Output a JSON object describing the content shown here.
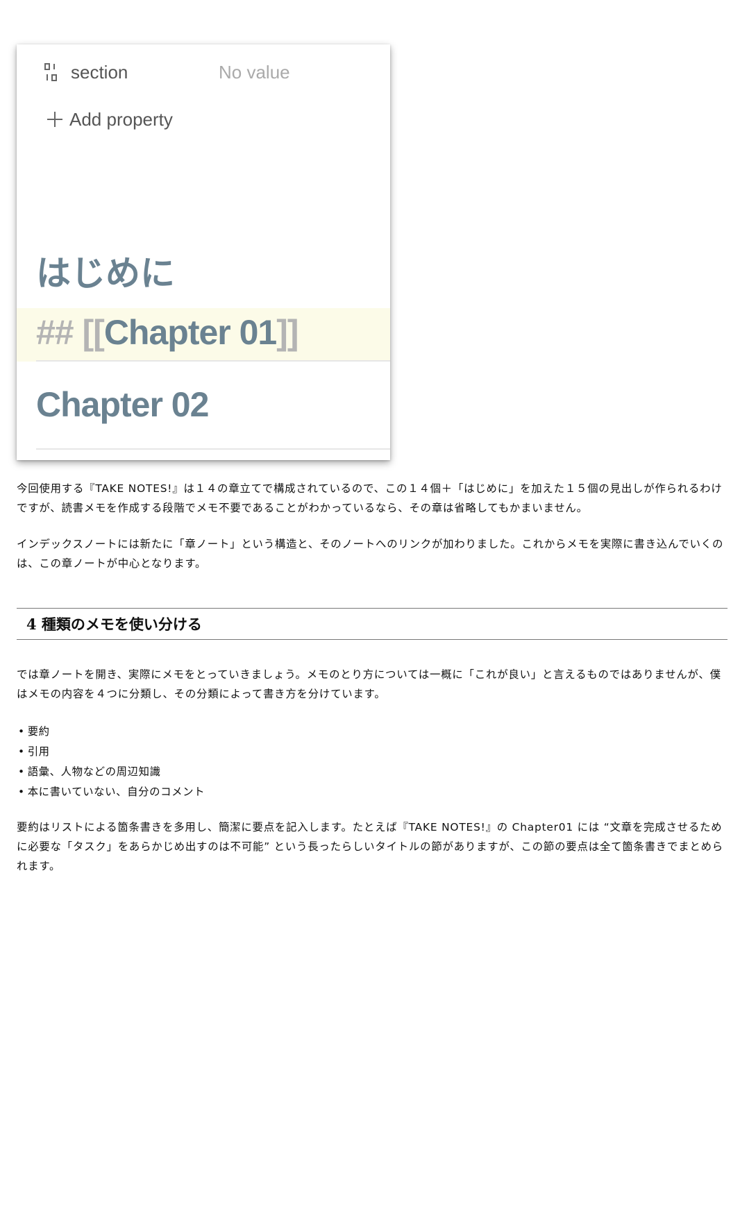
{
  "screenshot": {
    "property": {
      "icon": "section-property-icon",
      "name": "section",
      "value": "No value"
    },
    "add_property": {
      "icon": "plus-icon",
      "label": "Add property"
    },
    "headings": [
      {
        "text": "はじめに"
      },
      {
        "prefix": "## [[",
        "text": "Chapter 01",
        "suffix": "]]",
        "active": true
      },
      {
        "text": "Chapter 02"
      }
    ],
    "colors": {
      "heading": "#6a8291",
      "highlight": "#fcfbe8",
      "muted": "#b4b4b4"
    }
  },
  "article": {
    "paragraph_1": "今回使用する『TAKE NOTES!』は１４の章立てで構成されているので、この１４個＋「はじめに」を加えた１５個の見出しが作られるわけですが、読書メモを作成する段階でメモ不要であることがわかっているなら、その章は省略してもかまいません。",
    "paragraph_2": "インデックスノートには新たに「章ノート」という構造と、そのノートへのリンクが加わりました。これからメモを実際に書き込んでいくのは、この章ノートが中心となります。",
    "section_heading": "4 種類のメモを使い分ける",
    "paragraph_3": "では章ノートを開き、実際にメモをとっていきましょう。メモのとり方については一概に「これが良い」と言えるものではありませんが、僕はメモの内容を４つに分類し、その分類によって書き方を分けています。",
    "list": [
      "要約",
      "引用",
      "語彙、人物などの周辺知識",
      "本に書いていない、自分のコメント"
    ],
    "paragraph_4": "要約はリストによる箇条書きを多用し、簡潔に要点を記入します。たとえば『TAKE NOTES!』の Chapter01 には “文章を完成させるために必要な「タスク」をあらかじめ出すのは不可能” という長ったらしいタイトルの節がありますが、この節の要点は全て箇条書きでまとめられます。"
  }
}
